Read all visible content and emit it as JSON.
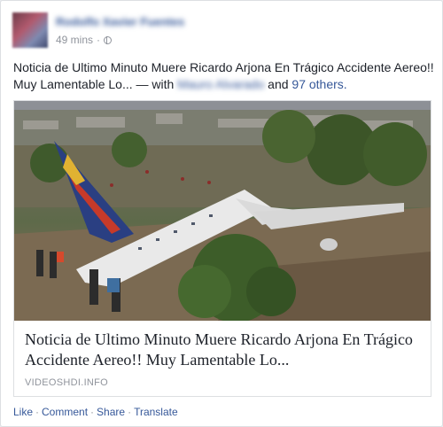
{
  "post": {
    "author": "Rodolfo Xavier Fuentes",
    "time": "49 mins",
    "separator": "·",
    "text": "Noticia de Ultimo Minuto Muere Ricardo Arjona En Trágico Accidente Aereo!! Muy Lamentable Lo... — with",
    "tagged_person": "Mauro Alvarado",
    "and_text": "and",
    "others": "97 others."
  },
  "share": {
    "image_alt": "Plane crash photo",
    "title": "Noticia de Ultimo Minuto Muere Ricardo Arjona En Trágico Accidente Aereo!! Muy Lamentable Lo...",
    "domain": "VIDEOSHDI.INFO"
  },
  "actions": {
    "like": "Like",
    "comment": "Comment",
    "share": "Share",
    "translate": "Translate",
    "sep": "·"
  },
  "colors": {
    "link": "#365899",
    "text": "#1d2129",
    "meta": "#90949c"
  }
}
